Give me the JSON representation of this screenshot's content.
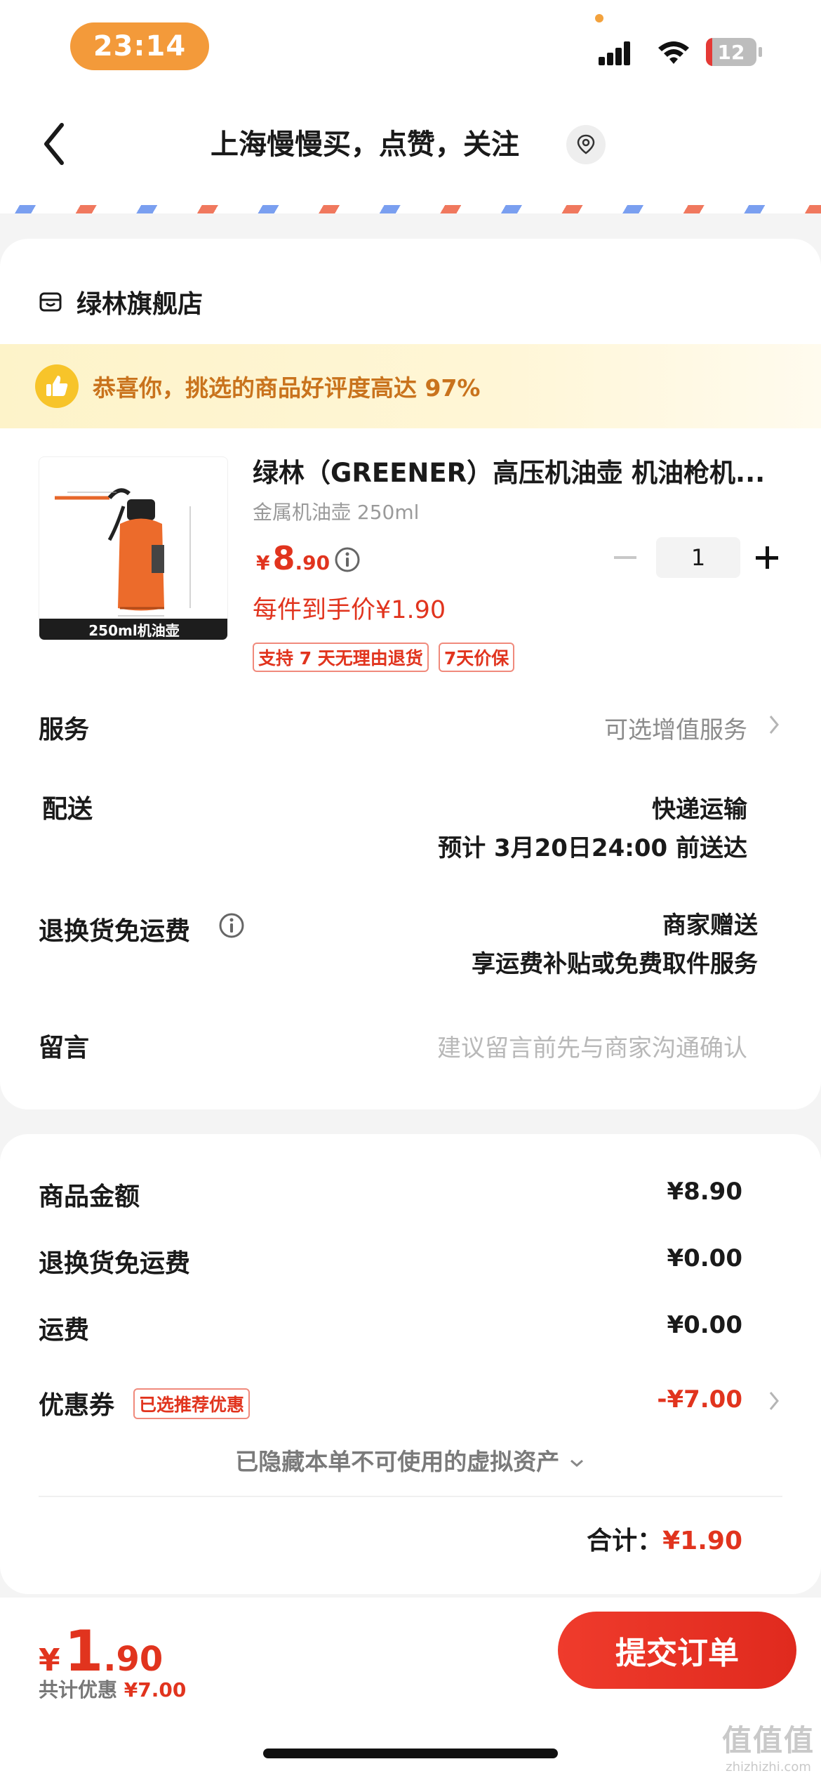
{
  "status_bar": {
    "time": "23:14",
    "battery": "12",
    "battery_level": 0.12
  },
  "header": {
    "title": "上海慢慢买，点赞，关注"
  },
  "store": {
    "name": "绿林旗舰店"
  },
  "banner": {
    "text": "恭喜你，挑选的商品好评度高达 97%"
  },
  "product": {
    "title": "绿林（GREENER）高压机油壶 机油枪机...",
    "spec": "金属机油壶 250ml",
    "price_symbol": "¥",
    "price_int": "8",
    "price_dec": ".90",
    "quantity": "1",
    "unit_price": "每件到手价¥1.90",
    "image_caption": "250ml机油壶",
    "tags": [
      "支持 7 天无理由退货",
      "7天价保"
    ]
  },
  "service": {
    "label": "服务",
    "value": "可选增值服务"
  },
  "delivery": {
    "label": "配送",
    "value": "快递运输",
    "eta": "预计 3月20日24:00 前送达"
  },
  "return_shipping": {
    "label": "退换货免运费",
    "value": "商家赠送",
    "sub": "享运费补贴或免费取件服务"
  },
  "message": {
    "label": "留言",
    "placeholder": "建议留言前先与商家沟通确认"
  },
  "summary": {
    "goods_label": "商品金额",
    "goods_value": "¥8.90",
    "return_label": "退换货免运费",
    "return_value": "¥0.00",
    "freight_label": "运费",
    "freight_value": "¥0.00",
    "coupon_label": "优惠券",
    "coupon_badge": "已选推荐优惠",
    "coupon_value": "-¥7.00",
    "hidden_note": "已隐藏本单不可使用的虚拟资产",
    "total_label": "合计：",
    "total_value": "¥1.90"
  },
  "bottom": {
    "price_symbol": "¥",
    "price_int": "1",
    "price_dec": ".90",
    "saved_label": "共计优惠",
    "saved_value": "¥7.00",
    "submit": "提交订单"
  },
  "watermark": {
    "logo": "值值值",
    "url": "zhizhizhi.com"
  },
  "colors": {
    "accent": "#e1341e",
    "banner_text": "#c9731d",
    "time_pill": "#f39a3a"
  }
}
